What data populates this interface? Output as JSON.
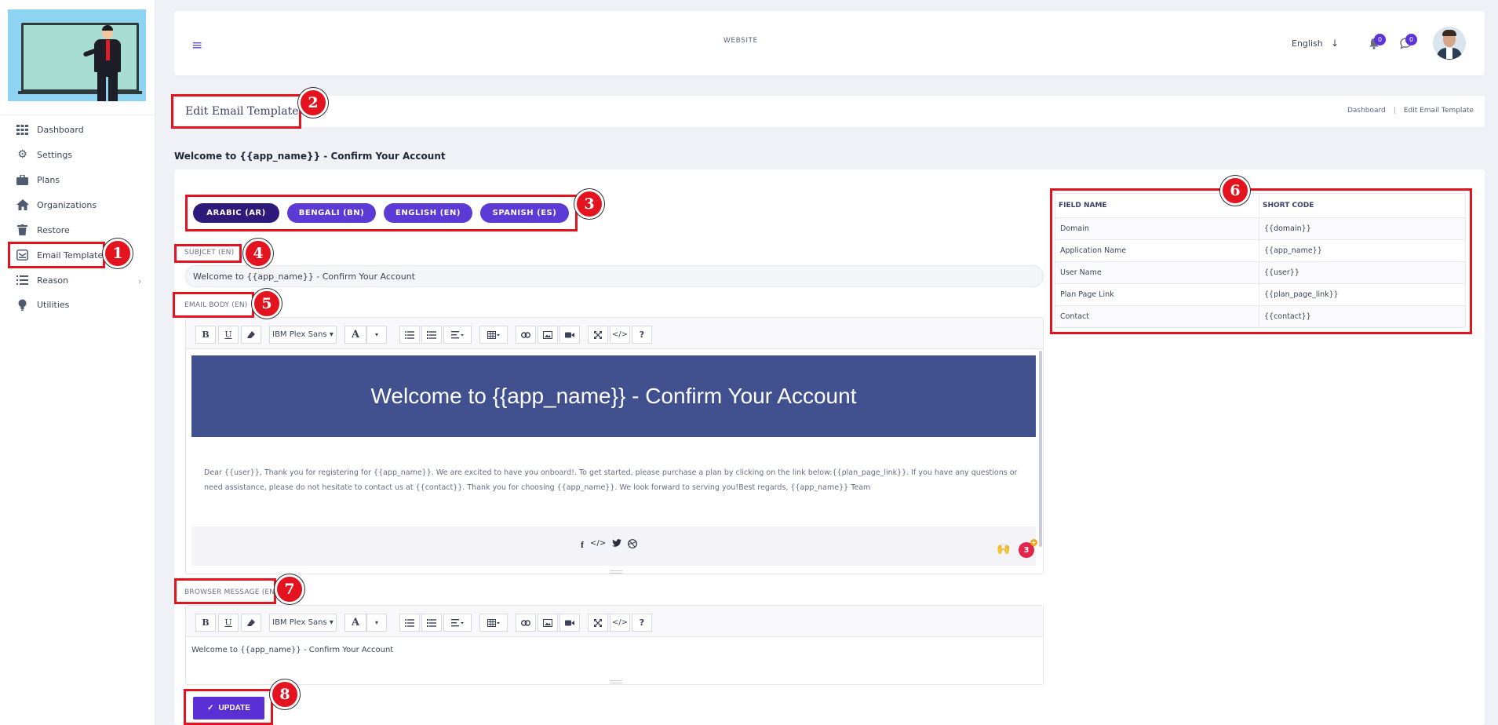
{
  "sidebar": {
    "items": [
      {
        "label": "Dashboard",
        "icon": "grid-icon"
      },
      {
        "label": "Settings",
        "icon": "gear-icon"
      },
      {
        "label": "Plans",
        "icon": "briefcase-icon"
      },
      {
        "label": "Organizations",
        "icon": "home-icon"
      },
      {
        "label": "Restore",
        "icon": "trash-icon"
      },
      {
        "label": "Email Template",
        "icon": "email-template-icon"
      },
      {
        "label": "Reason",
        "icon": "list-icon"
      },
      {
        "label": "Utilities",
        "icon": "bulb-icon"
      }
    ]
  },
  "header": {
    "site_label": "WEBSITE",
    "language": "English",
    "notifications_count": "0",
    "messages_count": "0"
  },
  "page": {
    "title": "Edit Email Template",
    "breadcrumb": [
      "Dashboard",
      "|",
      "Edit Email Template"
    ],
    "heading": "Welcome to {{app_name}} - Confirm Your Account"
  },
  "languages": [
    {
      "label": "ARABIC (AR)",
      "active": true
    },
    {
      "label": "BENGALI (BN)",
      "active": false
    },
    {
      "label": "ENGLISH (EN)",
      "active": false
    },
    {
      "label": "SPANISH (ES)",
      "active": false
    }
  ],
  "form": {
    "subject_label": "SUBJCET (EN)",
    "subject_value": "Welcome to {{app_name}} - Confirm Your Account",
    "body_label": "EMAIL BODY (EN)",
    "browser_label": "BROWSER MESSAGE (EN)",
    "browser_value": "Welcome to {{app_name}} - Confirm Your Account",
    "update_label": "UPDATE"
  },
  "toolbar": {
    "bold": "B",
    "underline": "U",
    "font": "IBM Plex Sans",
    "color": "A",
    "help": "?"
  },
  "email_preview": {
    "banner_title": "Welcome to {{app_name}} - Confirm Your Account",
    "body": "Dear {{user}}, Thank you for registering for {{app_name}}. We are excited to have you onboard!. To get started, please purchase a plan by clicking on the link below:{{plan_page_link}}. If you have any questions or need assistance, please do not hesitate to contact us at {{contact}}. Thank you for choosing {{app_name}}. We look forward to serving you!Best regards, {{app_name}} Team",
    "emoji_badge": "3"
  },
  "shortcodes": {
    "headers": [
      "FIELD NAME",
      "SHORT CODE"
    ],
    "rows": [
      [
        "Domain",
        "{{domain}}"
      ],
      [
        "Application Name",
        "{{app_name}}"
      ],
      [
        "User Name",
        "{{user}}"
      ],
      [
        "Plan Page Link",
        "{{plan_page_link}}"
      ],
      [
        "Contact",
        "{{contact}}"
      ]
    ]
  },
  "annotations": [
    "1",
    "2",
    "3",
    "4",
    "5",
    "6",
    "7",
    "8"
  ],
  "colors": {
    "accent": "#5b3ad6",
    "accent_dark": "#2d1a7a",
    "banner": "#41508e",
    "annotation": "#e3141f"
  }
}
